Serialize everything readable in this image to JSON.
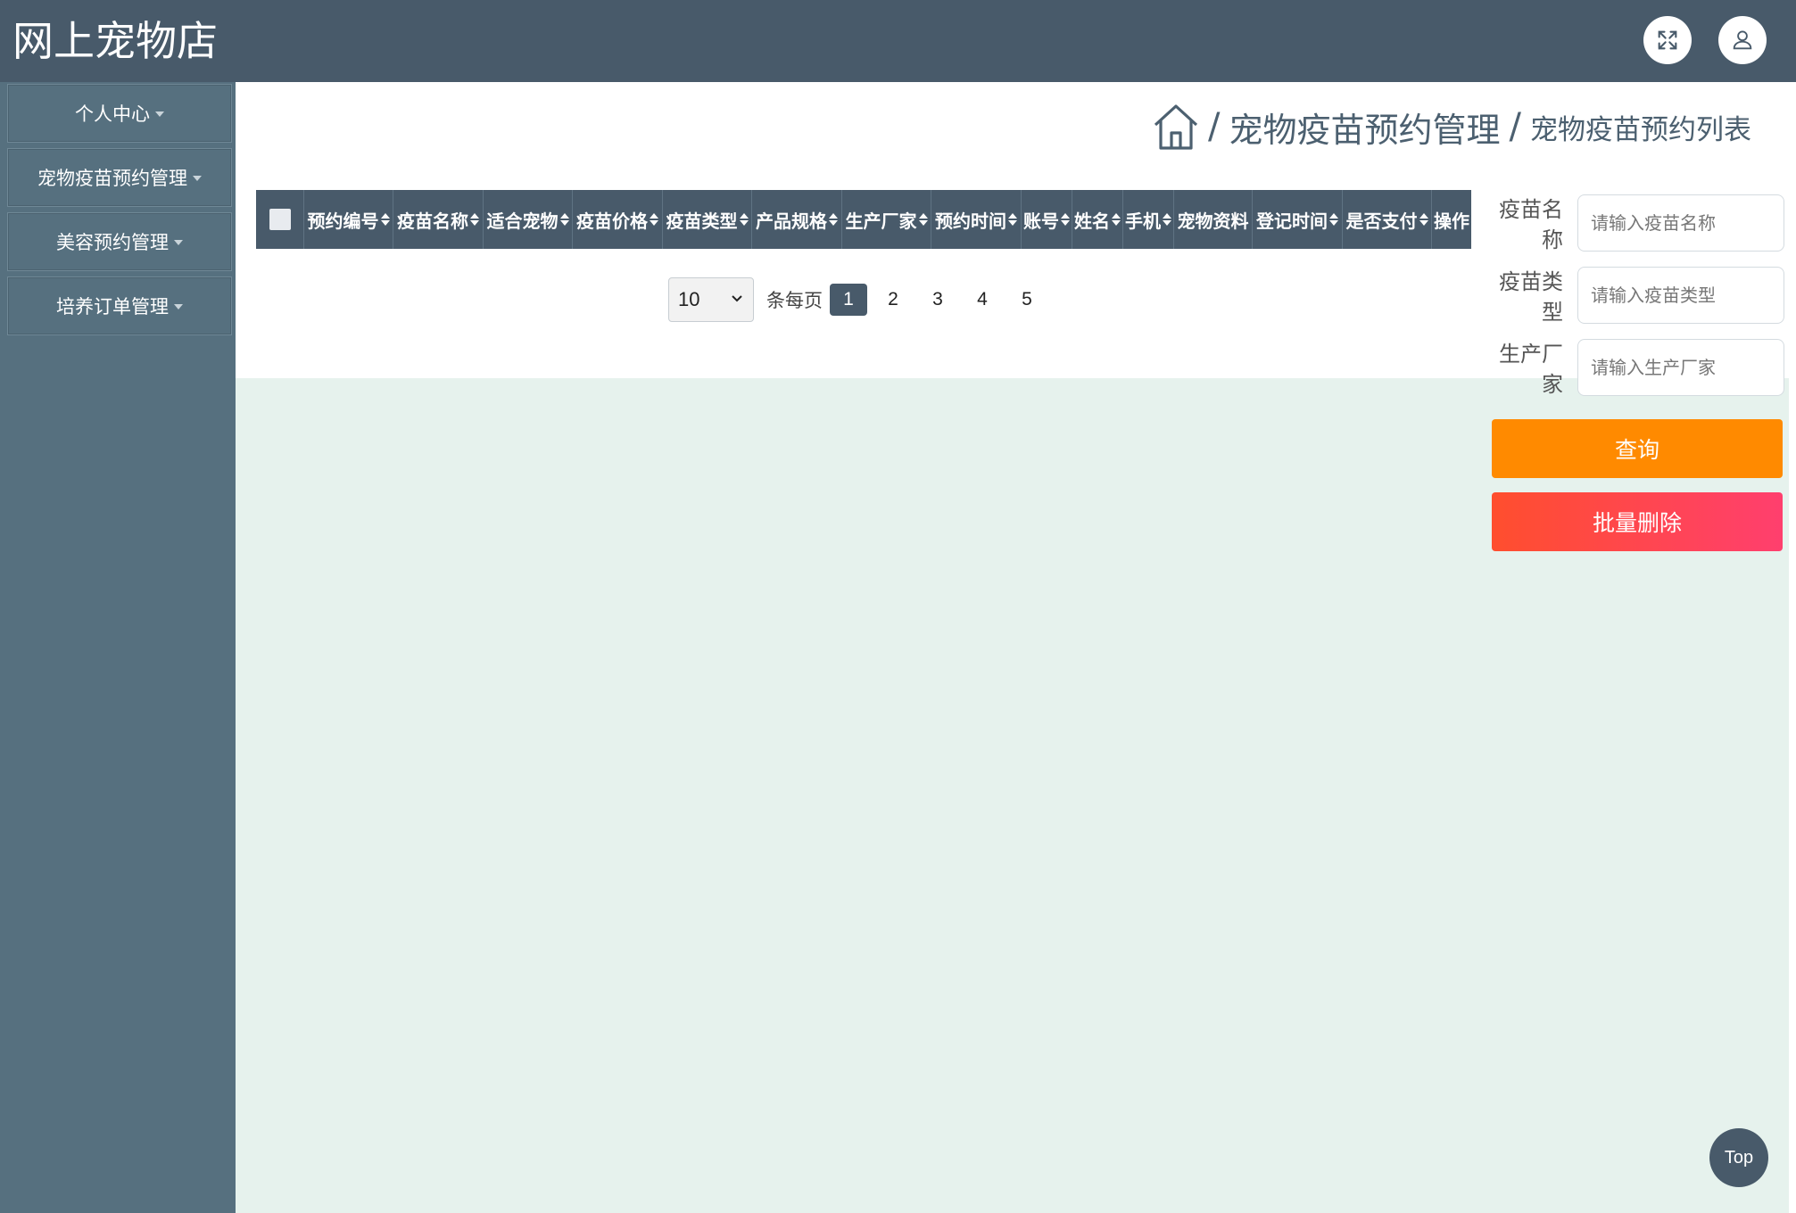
{
  "header": {
    "title": "网上宠物店",
    "fullscreen_icon": "expand-icon",
    "user_icon": "user-icon"
  },
  "sidebar": {
    "items": [
      {
        "label": "个人中心"
      },
      {
        "label": "宠物疫苗预约管理"
      },
      {
        "label": "美容预约管理"
      },
      {
        "label": "培养订单管理"
      }
    ]
  },
  "breadcrumb": {
    "home_icon": "home-icon",
    "separator": "/",
    "section": "宠物疫苗预约管理",
    "page": "宠物疫苗预约列表"
  },
  "table": {
    "columns": [
      {
        "label": "预约编号",
        "sortable": true
      },
      {
        "label": "疫苗名称",
        "sortable": true
      },
      {
        "label": "适合宠物",
        "sortable": true
      },
      {
        "label": "疫苗价格",
        "sortable": true
      },
      {
        "label": "疫苗类型",
        "sortable": true
      },
      {
        "label": "产品规格",
        "sortable": true
      },
      {
        "label": "生产厂家",
        "sortable": true
      },
      {
        "label": "预约时间",
        "sortable": true
      },
      {
        "label": "账号",
        "sortable": true
      },
      {
        "label": "姓名",
        "sortable": true
      },
      {
        "label": "手机",
        "sortable": true
      },
      {
        "label": "宠物资料",
        "sortable": false
      },
      {
        "label": "登记时间",
        "sortable": true
      },
      {
        "label": "是否支付",
        "sortable": true
      },
      {
        "label": "操作",
        "sortable": false
      }
    ],
    "rows": []
  },
  "pagination": {
    "page_size": "10",
    "per_page_label": "条每页",
    "pages": [
      "1",
      "2",
      "3",
      "4",
      "5"
    ],
    "current": "1"
  },
  "filters": {
    "fields": [
      {
        "label": "疫苗名称",
        "placeholder": "请输入疫苗名称",
        "value": ""
      },
      {
        "label": "疫苗类型",
        "placeholder": "请输入疫苗类型",
        "value": ""
      },
      {
        "label": "生产厂家",
        "placeholder": "请输入生产厂家",
        "value": ""
      }
    ],
    "query_label": "查询",
    "batch_delete_label": "批量删除"
  },
  "back_to_top": "Top",
  "colors": {
    "header_bg": "#485a6a",
    "sidebar_bg": "#56707f",
    "content_bg": "#e6f2ed",
    "query_button": "#ff8a00",
    "delete_button": "#ff4560"
  }
}
